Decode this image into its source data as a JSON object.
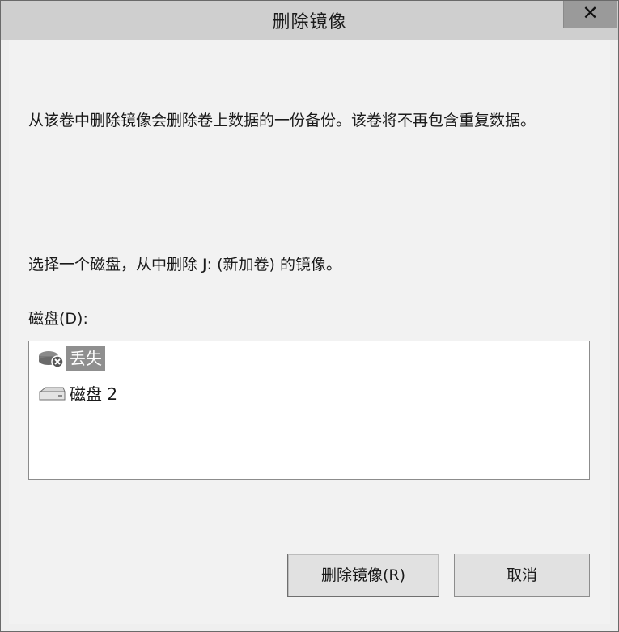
{
  "window": {
    "title": "删除镜像",
    "close_glyph": "✕"
  },
  "dialog": {
    "description": "从该卷中删除镜像会删除卷上数据的一份备份。该卷将不再包含重复数据。",
    "instruction": "选择一个磁盘，从中删除 J: (新加卷) 的镜像。",
    "disk_list_label": "磁盘(D):",
    "disks": [
      {
        "label": "丢失",
        "icon": "missing-disk-icon",
        "selected": true
      },
      {
        "label": "磁盘 2",
        "icon": "disk-drive-icon",
        "selected": false
      }
    ]
  },
  "buttons": {
    "remove_label": "删除镜像(R)",
    "cancel_label": "取消"
  }
}
